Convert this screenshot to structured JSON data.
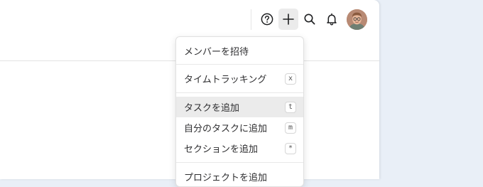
{
  "toolbar": {
    "help_icon": "help-circle-icon",
    "add_icon": "plus-icon",
    "search_icon": "search-icon",
    "notifications_icon": "bell-icon",
    "avatar": "user-avatar"
  },
  "quick_add_menu": {
    "items": [
      {
        "label": "メンバーを招待",
        "shortcut": ""
      },
      {
        "label": "タイムトラッキング",
        "shortcut": "x"
      },
      {
        "label": "タスクを追加",
        "shortcut": "t"
      },
      {
        "label": "自分のタスクに追加",
        "shortcut": "m"
      },
      {
        "label": "セクションを追加",
        "shortcut": "*"
      },
      {
        "label": "プロジェクトを追加",
        "shortcut": ""
      }
    ]
  },
  "colors": {
    "background": "#e9eff7",
    "panel": "#ffffff",
    "hover": "#ebebeb",
    "icon": "#1e1f21"
  }
}
